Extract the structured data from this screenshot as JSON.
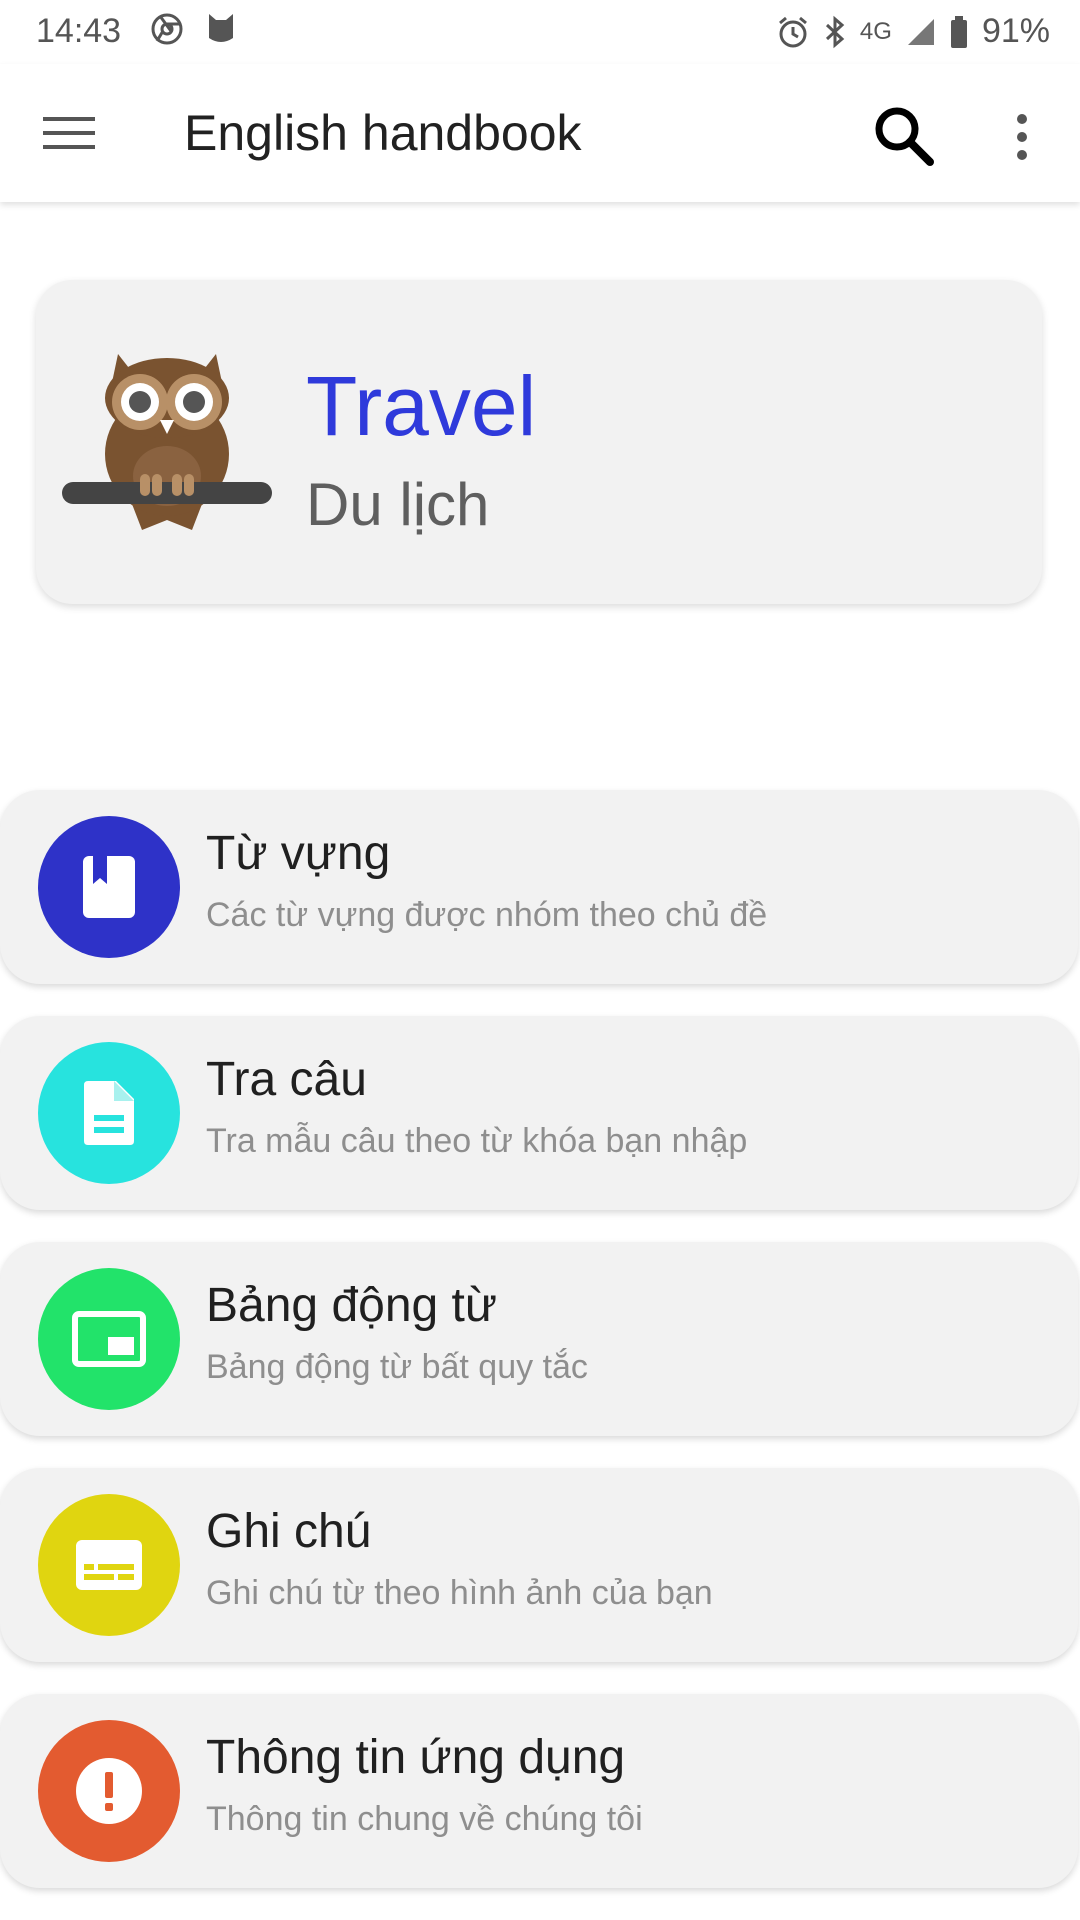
{
  "status_bar": {
    "time": "14:43",
    "network": "4G",
    "battery": "91%",
    "icons": [
      "chrome-icon",
      "app-notification-icon",
      "alarm-icon",
      "bluetooth-icon",
      "signal-icon",
      "battery-icon"
    ]
  },
  "app_bar": {
    "title": "English handbook",
    "icons": [
      "menu-icon",
      "search-icon",
      "more-vert-icon"
    ]
  },
  "hero": {
    "title": "Travel",
    "subtitle": "Du lịch",
    "icon": "owl-icon",
    "title_color": "#2f3adb"
  },
  "menu": {
    "items": [
      {
        "title": "Từ vựng",
        "subtitle": "Các từ vựng được nhóm theo chủ đề",
        "icon": "bookmark-book-icon",
        "color": "#2e32c8"
      },
      {
        "title": "Tra câu",
        "subtitle": "Tra mẫu câu theo từ khóa bạn nhập",
        "icon": "document-icon",
        "color": "#27e3de"
      },
      {
        "title": "Bảng động từ",
        "subtitle": "Bảng động từ bất quy tắc",
        "icon": "picture-in-picture-icon",
        "color": "#22e36a"
      },
      {
        "title": "Ghi chú",
        "subtitle": "Ghi chú từ theo hình ảnh của bạn",
        "icon": "subtitles-icon",
        "color": "#e0d510"
      },
      {
        "title": "Thông tin ứng dụng",
        "subtitle": "Thông tin chung về chúng tôi",
        "icon": "info-alert-icon",
        "color": "#e35b30"
      }
    ]
  }
}
